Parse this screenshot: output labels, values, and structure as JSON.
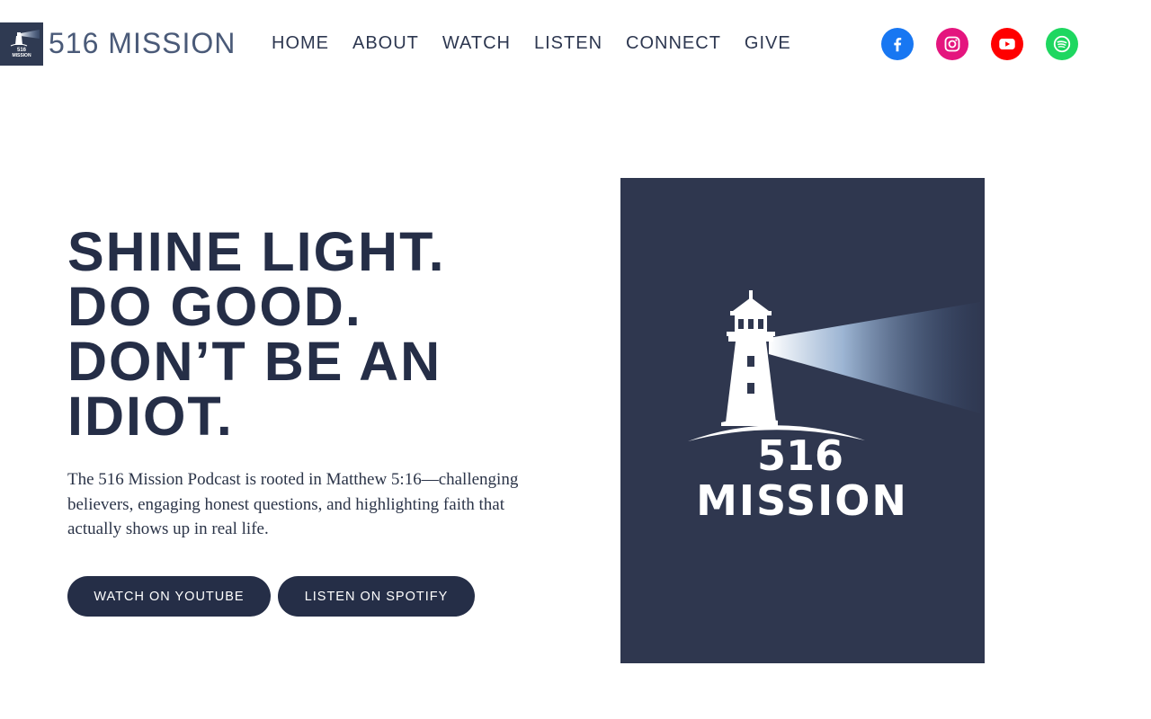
{
  "header": {
    "brand": "516 MISSION",
    "logo_small_text_1": "516",
    "logo_small_text_2": "MISSION",
    "nav": [
      "HOME",
      "ABOUT",
      "WATCH",
      "LISTEN",
      "CONNECT",
      "GIVE"
    ],
    "social": [
      {
        "name": "facebook-icon",
        "color": "#1877f2"
      },
      {
        "name": "instagram-icon",
        "color": "#e4157e"
      },
      {
        "name": "youtube-icon",
        "color": "#ff0000"
      },
      {
        "name": "spotify-icon",
        "color": "#1ed760"
      }
    ]
  },
  "hero": {
    "title_lines": [
      "SHINE LIGHT.",
      "DO GOOD.",
      "DON’T BE AN",
      "IDIOT."
    ],
    "description": "The 516 Mission Podcast is rooted in Matthew 5:16—challenging believers, engaging honest questions, and highlighting faith that actually shows up in real life.",
    "buttons": [
      "WATCH ON YOUTUBE",
      "LISTEN ON SPOTIFY"
    ]
  },
  "poster": {
    "number": "516",
    "word": "MISSION"
  },
  "colors": {
    "navy": "#252e47",
    "poster_bg": "#2f374f"
  }
}
